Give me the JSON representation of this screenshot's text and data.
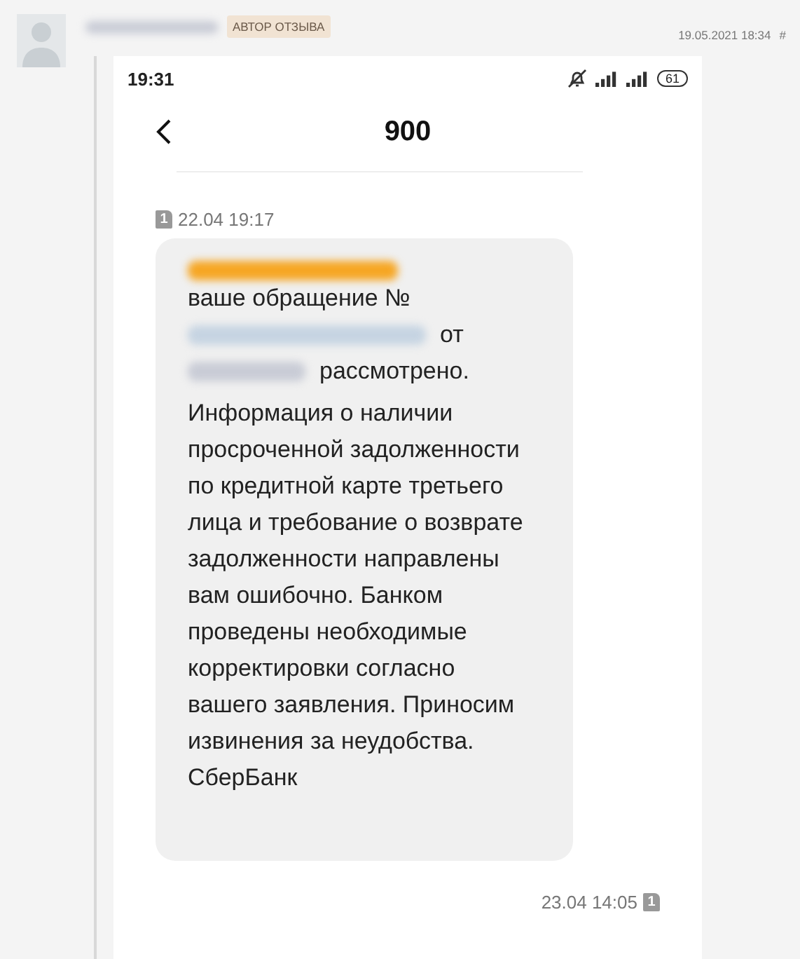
{
  "review": {
    "badge": "АВТОР ОТЗЫВА",
    "date": "19.05.2021 18:34",
    "anchor": "#"
  },
  "phone": {
    "time": "19:31",
    "battery": "61",
    "title": "900",
    "messages": [
      {
        "kind": "incoming",
        "stamp": "22.04 19:17",
        "sim": "1",
        "line_1": "ваше обращение №",
        "line_2_end": "от",
        "line_3_end": "рассмотрено.",
        "body": "Информация о наличии просроченной задолженности по кредитной карте третьего лица и требование о возврате задолженности направлены вам ошибочно. Банком проведены необходимые корректировки согласно вашего заявления. Приносим извинения за неудобства. СберБанк"
      },
      {
        "kind": "outgoing",
        "stamp": "23.04 14:05",
        "sim": "1"
      }
    ]
  }
}
